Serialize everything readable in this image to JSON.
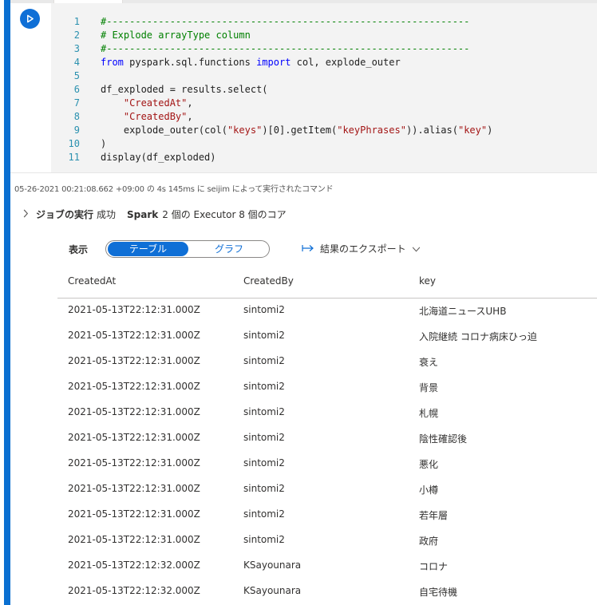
{
  "code": {
    "line_numbers": [
      "1",
      "2",
      "3",
      "4",
      "5",
      "6",
      "7",
      "8",
      "9",
      "10",
      "11"
    ],
    "lines": [
      [
        {
          "t": "#---------------------------------------------------------------",
          "c": "cmt"
        }
      ],
      [
        {
          "t": "# Explode arrayType column",
          "c": "cmt"
        }
      ],
      [
        {
          "t": "#---------------------------------------------------------------",
          "c": "cmt"
        }
      ],
      [
        {
          "t": "from",
          "c": "kw"
        },
        {
          "t": " pyspark.sql.functions ",
          "c": ""
        },
        {
          "t": "import",
          "c": "kw"
        },
        {
          "t": " col, explode_outer",
          "c": ""
        }
      ],
      [],
      [
        {
          "t": "df_exploded = results.select(",
          "c": ""
        }
      ],
      [
        {
          "t": "    ",
          "c": ""
        },
        {
          "t": "\"CreatedAt\"",
          "c": "str"
        },
        {
          "t": ",",
          "c": ""
        }
      ],
      [
        {
          "t": "    ",
          "c": ""
        },
        {
          "t": "\"CreatedBy\"",
          "c": "str"
        },
        {
          "t": ",",
          "c": ""
        }
      ],
      [
        {
          "t": "    explode_outer(col(",
          "c": ""
        },
        {
          "t": "\"keys\"",
          "c": "str"
        },
        {
          "t": ")[0].getItem(",
          "c": ""
        },
        {
          "t": "\"keyPhrases\"",
          "c": "str"
        },
        {
          "t": ")).alias(",
          "c": ""
        },
        {
          "t": "\"key\"",
          "c": "str"
        },
        {
          "t": ")",
          "c": ""
        }
      ],
      [
        {
          "t": ")",
          "c": ""
        }
      ],
      [
        {
          "t": "display(df_exploded)",
          "c": ""
        }
      ]
    ]
  },
  "exec_info": "05-26-2021 00:21:08.662 +09:00 の 4s 145ms に seijim によって実行されたコマンド",
  "jobs": {
    "label": "ジョブの実行",
    "status": "成功",
    "spark_label": "Spark",
    "spark_detail": "2 個の Executor 8 個のコア"
  },
  "view": {
    "display_label": "表示",
    "table_label": "テーブル",
    "graph_label": "グラフ",
    "export_label": "結果のエクスポート"
  },
  "table": {
    "headers": [
      "CreatedAt",
      "CreatedBy",
      "key"
    ],
    "rows": [
      [
        "2021-05-13T22:12:31.000Z",
        "sintomi2",
        "北海道ニュースUHB"
      ],
      [
        "2021-05-13T22:12:31.000Z",
        "sintomi2",
        "入院継続 コロナ病床ひっ迫"
      ],
      [
        "2021-05-13T22:12:31.000Z",
        "sintomi2",
        "衰え"
      ],
      [
        "2021-05-13T22:12:31.000Z",
        "sintomi2",
        "背景"
      ],
      [
        "2021-05-13T22:12:31.000Z",
        "sintomi2",
        "札幌"
      ],
      [
        "2021-05-13T22:12:31.000Z",
        "sintomi2",
        "陰性確認後"
      ],
      [
        "2021-05-13T22:12:31.000Z",
        "sintomi2",
        "悪化"
      ],
      [
        "2021-05-13T22:12:31.000Z",
        "sintomi2",
        "小樽"
      ],
      [
        "2021-05-13T22:12:31.000Z",
        "sintomi2",
        "若年層"
      ],
      [
        "2021-05-13T22:12:31.000Z",
        "sintomi2",
        "政府"
      ],
      [
        "2021-05-13T22:12:32.000Z",
        "KSayounara",
        "コロナ"
      ],
      [
        "2021-05-13T22:12:32.000Z",
        "KSayounara",
        "自宅待機"
      ]
    ]
  },
  "icons": [
    "play-icon",
    "chevron-right-icon",
    "export-arrow-icon",
    "chevron-down-icon"
  ],
  "colors": {
    "accent": "#0f6fd6",
    "cell_bar": "#0a6fd1",
    "code_bg": "#f3f3f3"
  }
}
